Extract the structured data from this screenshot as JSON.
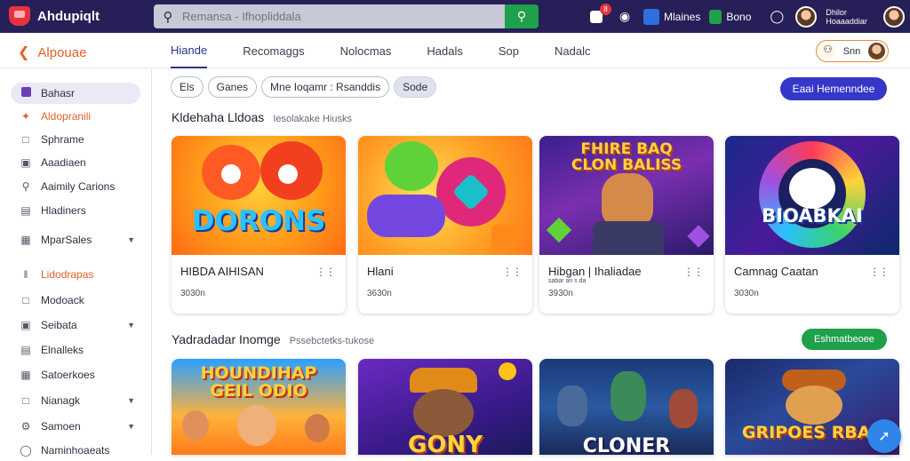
{
  "app": {
    "logo_text": "Ahdupiqlt"
  },
  "search": {
    "placeholder": "Remansa - Ifhopliddala"
  },
  "topbar": {
    "notif_count": "8",
    "link1": "Mlaines",
    "link2": "Bono",
    "user_line1": "Dhilor",
    "user_line2": "Hoaaaddiar"
  },
  "subnav": {
    "brand": "Alpouae",
    "tabs": [
      "Hiande",
      "Recomaggs",
      "Nolocmas",
      "Hadals",
      "Sop",
      "Nadalc"
    ],
    "promo_label": "Snn"
  },
  "sidebar": {
    "items": [
      {
        "label": "Bahasr",
        "icon": "games-icon"
      },
      {
        "label": "Aldopranili",
        "icon": "fire-icon"
      },
      {
        "label": "Sphrame",
        "icon": "device-icon"
      },
      {
        "label": "Aaadiaen",
        "icon": "puzzle-icon"
      },
      {
        "label": "Aaimily Carions",
        "icon": "trophy-icon"
      },
      {
        "label": "Hladiners",
        "icon": "clipboard-icon"
      },
      {
        "label": "MparSales",
        "icon": "grid-icon"
      },
      {
        "label": "Lidodrapas",
        "icon": "star-icon"
      },
      {
        "label": "Modoack",
        "icon": "box-icon"
      },
      {
        "label": "Seibata",
        "icon": "tag-icon"
      },
      {
        "label": "Elnalleks",
        "icon": "doc-icon"
      },
      {
        "label": "Satoerkoes",
        "icon": "layers-icon"
      },
      {
        "label": "Nianagk",
        "icon": "box-icon"
      },
      {
        "label": "Samoen",
        "icon": "settings-icon"
      },
      {
        "label": "Naminhoaeats",
        "icon": "info-icon"
      }
    ]
  },
  "chips": [
    "Els",
    "Ganes",
    "Mne Ioqamr : Rsanddis",
    "Sode"
  ],
  "cta_label": "Eaai Hemenndee",
  "section1": {
    "title": "Kldehaha Lldoas",
    "sub": "Iesolakake  Hiusks"
  },
  "section2": {
    "title": "Yadradadar Inomge",
    "sub": "Pssebctetks-tukose"
  },
  "section2_button": "Eshmatbeoee",
  "cards_row1": [
    {
      "thumb_text": "DORONS",
      "title": "HIBDA AIHISAN",
      "meta": "3030n",
      "tiny": ""
    },
    {
      "thumb_text": "",
      "title": "Hlani",
      "meta": "3630n",
      "tiny": ""
    },
    {
      "thumb_text": "FHIRE BAQ CLON BALISS",
      "title": "Hibgan | Ihaliadae",
      "meta": "3930n",
      "tiny": "sabar an s da"
    },
    {
      "thumb_text": "BIOABKAI",
      "title": "Camnag  Caatan",
      "meta": "3030n",
      "tiny": ""
    }
  ],
  "cards_row2": [
    {
      "thumb_text": "HOUNDIHAP GEIL ODIO"
    },
    {
      "thumb_text": "GONY"
    },
    {
      "thumb_text": "CLONER"
    },
    {
      "thumb_text": "GRIPOES RBAS"
    }
  ],
  "colors": {
    "topbar": "#271f57",
    "accent": "#3537c8",
    "brand_orange": "#e0612a",
    "green": "#1fa04a",
    "notif_red": "#e8333f"
  }
}
